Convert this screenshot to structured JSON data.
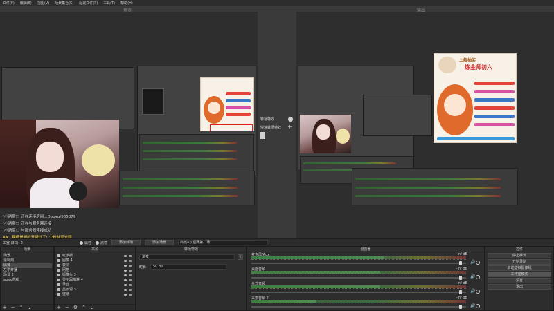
{
  "menu": [
    "文件(F)",
    "编辑(E)",
    "视图(V)",
    "场景集合(S)",
    "配置文件(P)",
    "工具(T)",
    "帮助(H)"
  ],
  "preview_label": "预览",
  "program_label": "输出",
  "transition_mid": {
    "quick_label": "转场特效",
    "studio_label": "快速转场特效"
  },
  "chat": [
    "[小酒窝]：正在连接房间...Douyu/505879",
    "[小酒窝]：正在与服务器连接",
    "[小酒窝]：与服务器连接成功",
    "AA：糖纸是超的开播过了! 个粉丝爱光顾"
  ],
  "statusbar": {
    "mode_text": "工室 (3D): 2",
    "radio_label_1": "属性",
    "radio_label_2": "滤镜",
    "btn_add_transition": "添加转场",
    "btn_add_scene": "添加场景",
    "scene_name": "商城a以后赛第二场"
  },
  "docks": {
    "scenes_title": "场景",
    "sources_title": "来源",
    "transitions_title": "转场特效",
    "mixer_title": "混音器",
    "controls_title": "控件"
  },
  "scenes": [
    "场景",
    "录制用",
    "比赛",
    "左学开播",
    "场景 2",
    "apex游戏"
  ],
  "selected_scene": 2,
  "sources": [
    "吃饭版",
    "图像 4",
    "表情",
    "网格",
    "摄像头 3",
    "显示器捕获 4",
    "录音",
    "显示源 3",
    "壁纸"
  ],
  "transitions": {
    "type_value": "渐变",
    "duration_label": "时长",
    "duration_value": "50 ms"
  },
  "mixer": [
    {
      "name": "麦克风/Aux",
      "db": "-inf dB",
      "level": 0.62,
      "volume": 0.98
    },
    {
      "name": "桌面音频",
      "db": "-inf dB",
      "level": 0.6,
      "volume": 0.98
    },
    {
      "name": "台式音频",
      "db": "-inf dB",
      "level": 0.6,
      "volume": 0.98
    },
    {
      "name": "采集音频 2",
      "db": "-inf dB",
      "level": 0.3,
      "volume": 0.98
    }
  ],
  "controls": [
    "停止推流",
    "开始录制",
    "启动虚拟摄像机",
    "工作室模式",
    "设置",
    "退出"
  ],
  "active_control": 3,
  "poster": {
    "title": "上舰抽奖",
    "subtitle": "炼金师初六"
  },
  "colors": {
    "background": "#2b2b2b",
    "accent_green": "#4fbf4f",
    "highlight_red": "#d02a2a"
  }
}
